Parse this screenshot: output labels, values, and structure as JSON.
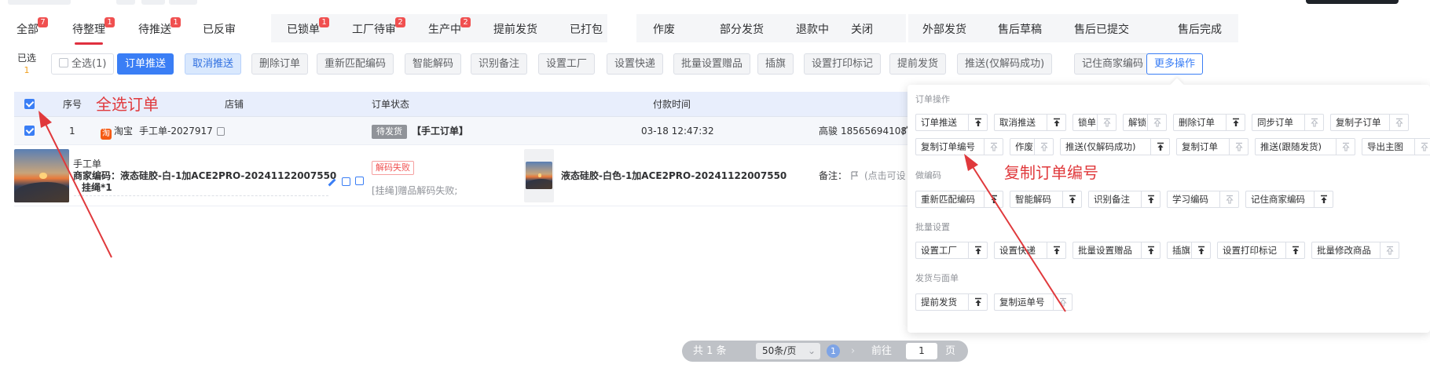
{
  "tabs": [
    {
      "label": "全部",
      "badge": "7"
    },
    {
      "label": "待整理",
      "badge": "1",
      "active": true
    },
    {
      "label": "待推送",
      "badge": "1"
    },
    {
      "label": "已反审",
      "badge": null
    },
    {
      "label": "已锁单",
      "badge": "1"
    },
    {
      "label": "工厂待审",
      "badge": "2"
    },
    {
      "label": "生产中",
      "badge": "2"
    },
    {
      "label": "提前发货",
      "badge": null
    },
    {
      "label": "已打包",
      "badge": null
    },
    {
      "label": "作废",
      "badge": null
    },
    {
      "label": "部分发货",
      "badge": null
    },
    {
      "label": "退款中",
      "badge": null
    },
    {
      "label": "关闭",
      "badge": null
    },
    {
      "label": "外部发货",
      "badge": null
    },
    {
      "label": "售后草稿",
      "badge": null
    },
    {
      "label": "售后已提交",
      "badge": null
    },
    {
      "label": "售后完成",
      "badge": null
    }
  ],
  "toolbar": {
    "selected_label": "已选",
    "selected_count": "1",
    "select_all": "全选(1)",
    "buttons": [
      "订单推送",
      "取消推送",
      "删除订单",
      "重新匹配编码",
      "智能解码",
      "识别备注",
      "设置工厂",
      "设置快递",
      "批量设置赠品",
      "插旗",
      "设置打印标记",
      "提前发货",
      "推送(仅解码成功)",
      "记住商家编码",
      "更多操作"
    ]
  },
  "table": {
    "headers": [
      "序号",
      "店铺",
      "订单状态",
      "付款时间"
    ],
    "row": {
      "index": "1",
      "platform_icon": "淘",
      "platform": "淘宝",
      "order_no": "手工单-2027917",
      "status_tag": "待发货",
      "order_type": "【手工订单】",
      "pay_time": "03-18 12:47:32",
      "receiver": "高骏",
      "phone": "18565694108",
      "phone_suffix": "广"
    },
    "detail": {
      "source": "手工单",
      "merchant_code": "商家编码：液态硅胶-白-1加ACE2PRO-20241122007550",
      "quantity": "挂绳*1",
      "decode_tag": "解码失败",
      "decode_msg": "[挂绳]赠品解码失败;",
      "product_name": "液态硅胶-白色-1加ACE2PRO-20241122007550",
      "remark_label": "备注：",
      "remark_action": "(点击可设"
    }
  },
  "more_ops": {
    "sections": [
      {
        "title": "订单操作",
        "rows": [
          [
            {
              "label": "订单推送",
              "pinned": true
            },
            {
              "label": "取消推送",
              "pinned": true
            },
            {
              "label": "锁单",
              "pinned": false
            },
            {
              "label": "解锁",
              "pinned": false
            },
            {
              "label": "删除订单",
              "pinned": true
            },
            {
              "label": "同步订单",
              "pinned": false
            },
            {
              "label": "复制子订单",
              "pinned": false
            }
          ],
          [
            {
              "label": "复制订单编号",
              "pinned": false
            },
            {
              "label": "作废",
              "pinned": false
            },
            {
              "label": "推送(仅解码成功)",
              "pinned": true
            },
            {
              "label": "复制订单",
              "pinned": false
            },
            {
              "label": "推送(跟随发货)",
              "pinned": false
            },
            {
              "label": "导出主图",
              "pinned": false
            }
          ]
        ]
      },
      {
        "title": "做编码",
        "rows": [
          [
            {
              "label": "重新匹配编码",
              "pinned": true
            },
            {
              "label": "智能解码",
              "pinned": true
            },
            {
              "label": "识别备注",
              "pinned": true
            },
            {
              "label": "学习编码",
              "pinned": false
            },
            {
              "label": "记住商家编码",
              "pinned": true
            }
          ]
        ]
      },
      {
        "title": "批量设置",
        "rows": [
          [
            {
              "label": "设置工厂",
              "pinned": true
            },
            {
              "label": "设置快递",
              "pinned": true
            },
            {
              "label": "批量设置赠品",
              "pinned": true
            },
            {
              "label": "插旗",
              "pinned": true
            },
            {
              "label": "设置打印标记",
              "pinned": true
            },
            {
              "label": "批量修改商品",
              "pinned": false
            }
          ]
        ]
      },
      {
        "title": "发货与面单",
        "rows": [
          [
            {
              "label": "提前发货",
              "pinned": true
            },
            {
              "label": "复制运单号",
              "pinned": false
            }
          ]
        ]
      }
    ]
  },
  "pagination": {
    "total": "共 1 条",
    "page_size": "50条/页",
    "current": "1",
    "goto_label": "前往",
    "goto_value": "1",
    "page_unit": "页"
  },
  "annotations": {
    "select_all": "全选订单",
    "copy_order_no": "复制订单编号",
    "color": "#e0393c"
  }
}
